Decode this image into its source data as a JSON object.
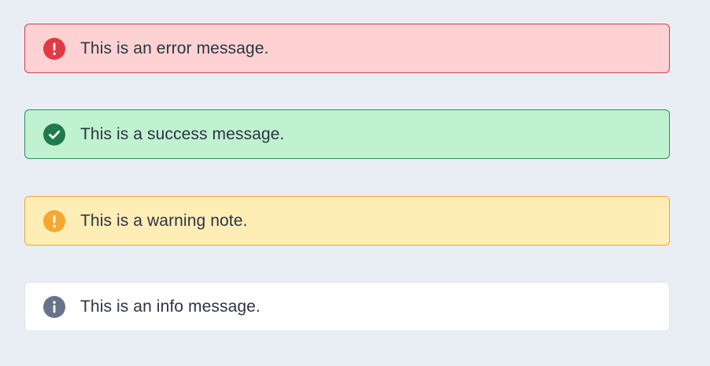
{
  "alerts": [
    {
      "type": "error",
      "message": "This is an error message.",
      "icon": "error-exclamation-icon",
      "background": "#fed2d2",
      "border": "#dc3a45",
      "icon_color": "#e23a44"
    },
    {
      "type": "success",
      "message": "This is a success message.",
      "icon": "success-check-icon",
      "background": "#c0f1d0",
      "border": "#2f8f5e",
      "icon_color": "#1f7a4c"
    },
    {
      "type": "warning",
      "message": "This is a warning note.",
      "icon": "warning-exclamation-icon",
      "background": "#feeeb6",
      "border": "#f2a530",
      "icon_color": "#f7a731"
    },
    {
      "type": "info",
      "message": "This is an info message.",
      "icon": "info-icon",
      "background": "#ffffff",
      "border": "#dde3ea",
      "icon_color": "#677388"
    }
  ]
}
